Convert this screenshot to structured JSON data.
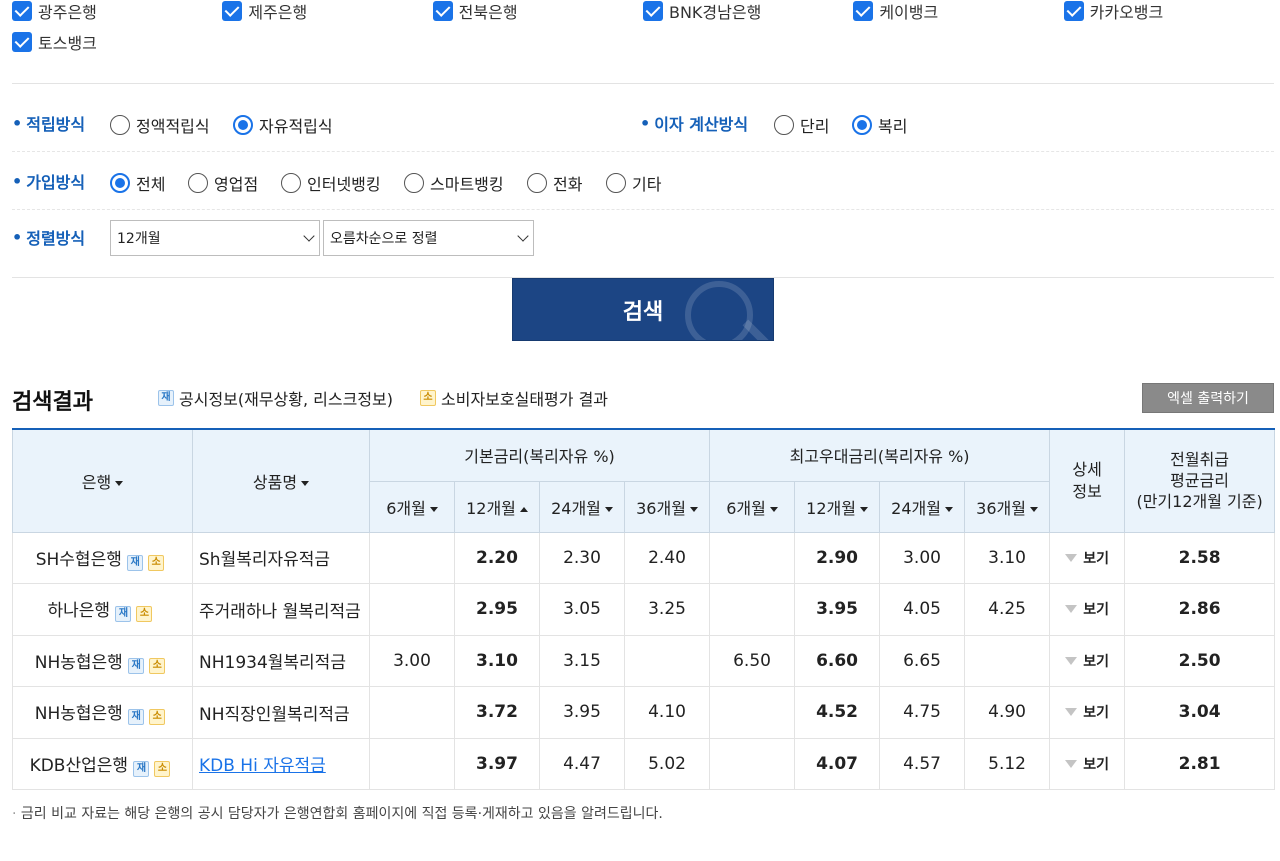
{
  "banks": [
    "광주은행",
    "제주은행",
    "전북은행",
    "BNK경남은행",
    "케이뱅크",
    "카카오뱅크",
    "토스뱅크"
  ],
  "options": {
    "savings_method": {
      "title": "적립방식",
      "items": [
        "정액적립식",
        "자유적립식"
      ],
      "selected": "자유적립식"
    },
    "interest_method": {
      "title": "이자 계산방식",
      "items": [
        "단리",
        "복리"
      ],
      "selected": "복리"
    },
    "join_method": {
      "title": "가입방식",
      "items": [
        "전체",
        "영업점",
        "인터넷뱅킹",
        "스마트뱅킹",
        "전화",
        "기타"
      ],
      "selected": "전체"
    },
    "sort_method": {
      "title": "정렬방식",
      "period": "12개월",
      "order": "오름차순으로 정렬"
    }
  },
  "search_button": "검색",
  "results": {
    "title": "검색결과",
    "legend_disclosure": "공시정보(재무상황, 리스크정보)",
    "legend_consumer": "소비자보호실태평가 결과",
    "tag_j": "재",
    "tag_s": "소",
    "excel_button": "엑셀 출력하기",
    "headers": {
      "bank": "은행",
      "product": "상품명",
      "base_rate": "기본금리(복리자유 %)",
      "max_rate": "최고우대금리(복리자유 %)",
      "detail": "상세 정보",
      "avg_line1": "전월취급",
      "avg_line2": "평균금리",
      "avg_line3": "(만기12개월 기준)",
      "periods": [
        "6개월",
        "12개월",
        "24개월",
        "36개월"
      ]
    },
    "view_label": "보기",
    "rows": [
      {
        "bank": "SH수협은행",
        "product": "Sh월복리자유적금",
        "base": [
          "",
          "2.20",
          "2.30",
          "2.40"
        ],
        "max": [
          "",
          "2.90",
          "3.00",
          "3.10"
        ],
        "avg": "2.58"
      },
      {
        "bank": "하나은행",
        "product": "주거래하나 월복리적금",
        "base": [
          "",
          "2.95",
          "3.05",
          "3.25"
        ],
        "max": [
          "",
          "3.95",
          "4.05",
          "4.25"
        ],
        "avg": "2.86"
      },
      {
        "bank": "NH농협은행",
        "product": "NH1934월복리적금",
        "base": [
          "3.00",
          "3.10",
          "3.15",
          ""
        ],
        "max": [
          "6.50",
          "6.60",
          "6.65",
          ""
        ],
        "avg": "2.50"
      },
      {
        "bank": "NH농협은행",
        "product": "NH직장인월복리적금",
        "base": [
          "",
          "3.72",
          "3.95",
          "4.10"
        ],
        "max": [
          "",
          "4.52",
          "4.75",
          "4.90"
        ],
        "avg": "3.04"
      },
      {
        "bank": "KDB산업은행",
        "product": "KDB Hi 자유적금",
        "base": [
          "",
          "3.97",
          "4.47",
          "5.02"
        ],
        "max": [
          "",
          "4.07",
          "4.57",
          "5.12"
        ],
        "avg": "2.81"
      }
    ]
  },
  "footnote": "금리 비교 자료는 해당 은행의 공시 담당자가 은행연합회 홈페이지에 직접 등록·게재하고 있음을 알려드립니다."
}
